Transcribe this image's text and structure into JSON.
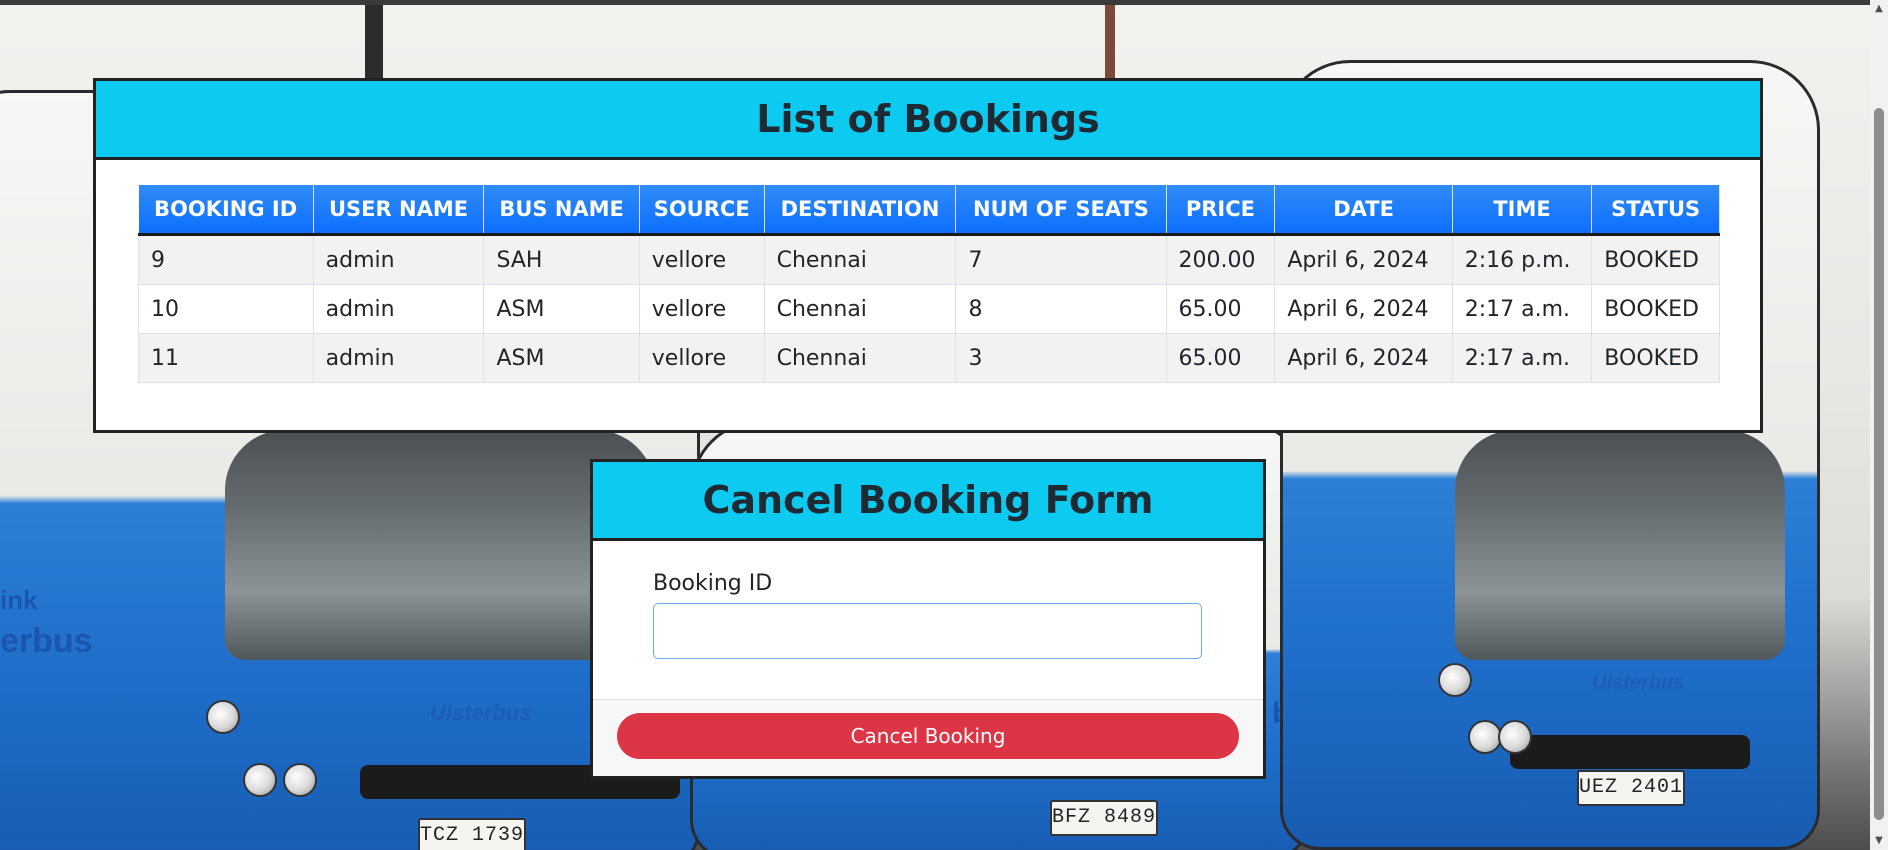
{
  "bookings": {
    "title": "List of Bookings",
    "columns": [
      "BOOKING ID",
      "USER NAME",
      "BUS NAME",
      "SOURCE",
      "DESTINATION",
      "NUM OF SEATS",
      "PRICE",
      "DATE",
      "TIME",
      "STATUS"
    ],
    "rows": [
      [
        "9",
        "admin",
        "SAH",
        "vellore",
        "Chennai",
        "7",
        "200.00",
        "April 6, 2024",
        "2:16 p.m.",
        "BOOKED"
      ],
      [
        "10",
        "admin",
        "ASM",
        "vellore",
        "Chennai",
        "8",
        "65.00",
        "April 6, 2024",
        "2:17 a.m.",
        "BOOKED"
      ],
      [
        "11",
        "admin",
        "ASM",
        "vellore",
        "Chennai",
        "3",
        "65.00",
        "April 6, 2024",
        "2:17 a.m.",
        "BOOKED"
      ]
    ]
  },
  "cancel_form": {
    "title": "Cancel Booking Form",
    "field_label": "Booking ID",
    "field_value": "",
    "button_label": "Cancel Booking"
  },
  "background": {
    "plates": [
      "TCZ 1739",
      "BFZ 8489",
      "UEZ 2401"
    ],
    "brand": "Ulsterbus",
    "brand_partial_top": "ink",
    "brand_partial_bottom": "erbus",
    "brand_partial_middle": "bus"
  },
  "colors": {
    "header_cyan": "#0dcaf0",
    "table_header_blue": "#0d6efd",
    "danger_red": "#dc3545"
  },
  "icons": {
    "scroll_up": "▲",
    "scroll_down": "▼"
  }
}
